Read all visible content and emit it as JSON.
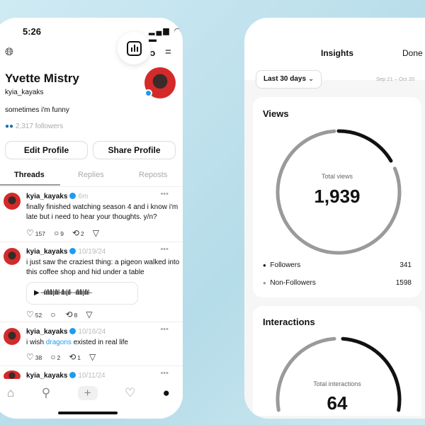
{
  "status_time": "5:26",
  "profile": {
    "name": "Yvette Mistry",
    "handle": "kyia_kayaks",
    "bio": "sometimes i'm funny",
    "followers": "2,317 followers",
    "edit": "Edit Profile",
    "share": "Share Profile",
    "tabs": [
      "Threads",
      "Replies",
      "Reposts"
    ]
  },
  "posts": [
    {
      "user": "kyia_kayaks",
      "time": "6m",
      "text": "finally finished watching season 4 and i know i'm late but i need to hear your thoughts. y/n?",
      "likes": "157",
      "comments": "9",
      "reposts": "2"
    },
    {
      "user": "kyia_kayaks",
      "time": "10/19/24",
      "text": "i just saw the craziest thing: a pigeon walked into this coffee shop and hid under a table",
      "likes": "52",
      "comments": "",
      "reposts": "8"
    },
    {
      "user": "kyia_kayaks",
      "time": "10/16/24",
      "text_pre": "i wish ",
      "link": "dragons",
      "text_post": " existed in real life",
      "likes": "38",
      "comments": "2",
      "reposts": "1"
    },
    {
      "user": "kyia_kayaks",
      "time": "10/11/24"
    }
  ],
  "insights": {
    "title": "Insights",
    "done": "Done",
    "range": "Last 30 days",
    "dates": "Sep 21 – Oct 20",
    "views": {
      "title": "Views",
      "total_label": "Total views",
      "total": "1,939",
      "followers_label": "Followers",
      "followers": 341,
      "non_label": "Non-Followers",
      "non": 1598
    },
    "interactions": {
      "title": "Interactions",
      "total_label": "Total interactions",
      "total": "64"
    }
  },
  "colors": {
    "accent": "#1d9bf0",
    "ring_dark": "#111111",
    "ring_light": "#9a9a9a"
  }
}
